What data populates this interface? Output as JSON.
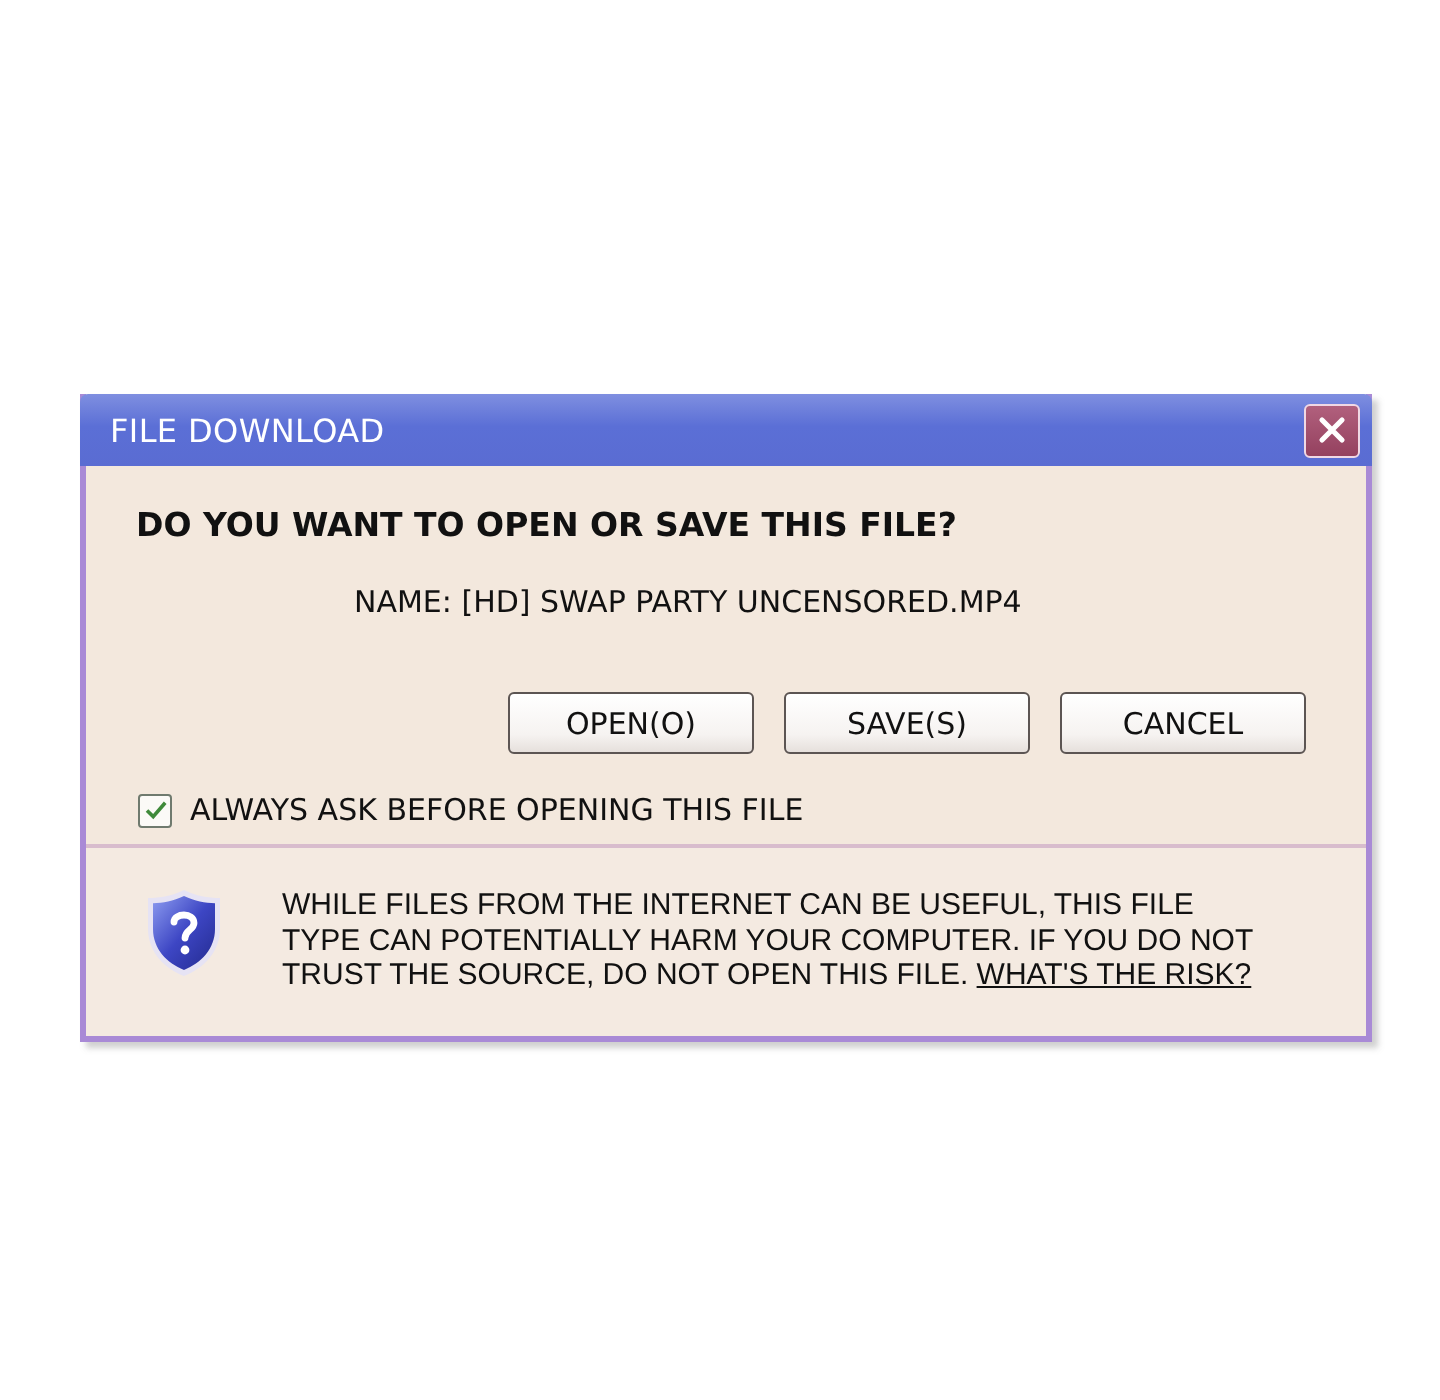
{
  "window": {
    "title": "FILE DOWNLOAD"
  },
  "heading": "DO YOU WANT TO OPEN OR SAVE THIS FILE?",
  "file_name": "NAME: [HD] SWAP PARTY UNCENSORED.MP4",
  "buttons": [
    {
      "label": "OPEN(O)"
    },
    {
      "label": "SAVE(S)"
    },
    {
      "label": "CANCEL"
    }
  ],
  "checkbox": {
    "label": "ALWAYS ASK BEFORE OPENING THIS FILE",
    "checked": true
  },
  "warning": {
    "lines": [
      "WHILE FILES FROM THE INTERNET CAN BE USEFUL, THIS FILE",
      "TYPE CAN POTENTIALLY HARM YOUR COMPUTER. IF YOU DO NOT",
      "TRUST THE SOURCE, DO NOT OPEN THIS FILE."
    ],
    "link": "WHAT'S THE RISK?"
  }
}
